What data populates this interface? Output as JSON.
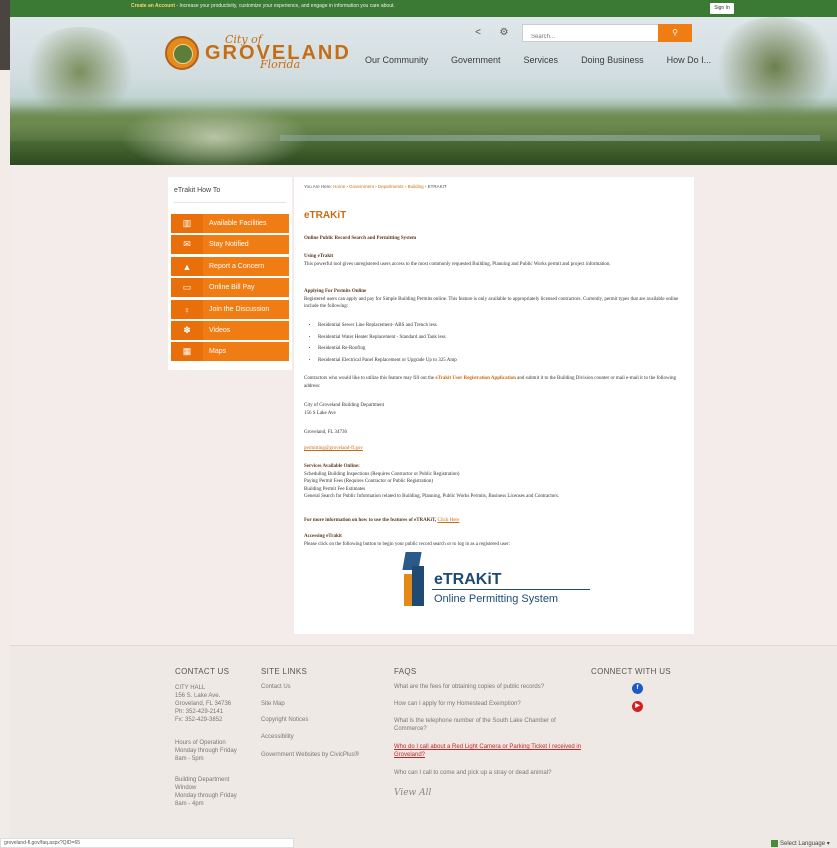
{
  "topbar": {
    "account_link": "Create an Account",
    "account_text": " - Increase your productivity, customize your experience, and engage in information you care about.",
    "signin": "Sign In"
  },
  "logo": {
    "city_of": "City of",
    "name": "GROVELAND",
    "state": "Florida"
  },
  "search": {
    "placeholder": "Search..."
  },
  "icons": {
    "share": "share-icon",
    "settings": "gear-icon",
    "search": "search-icon"
  },
  "nav": [
    "Our Community",
    "Government",
    "Services",
    "Doing Business",
    "How Do I..."
  ],
  "sidebar": {
    "title": "eTrakit How To",
    "items": [
      {
        "label": "Available Facilities",
        "icon": "building-icon"
      },
      {
        "label": "Stay Notified",
        "icon": "envelope-icon"
      },
      {
        "label": "Report a Concern",
        "icon": "bell-icon"
      },
      {
        "label": "Online Bill Pay",
        "icon": "credit-card-icon"
      },
      {
        "label": "Join the Discussion",
        "icon": "microphone-icon"
      },
      {
        "label": "Videos",
        "icon": "film-reel-icon"
      },
      {
        "label": "Maps",
        "icon": "map-icon"
      }
    ]
  },
  "breadcrumb": {
    "prefix": "You Are Here: ",
    "items": [
      "Home",
      "Government",
      "Departments",
      "Building"
    ],
    "current": "ETRAKIT"
  },
  "page": {
    "title": "eTRAKiT",
    "heading": "Online Public Record Search and Permitting System",
    "using_title": "Using eTrakit",
    "using_text": "This powerful tool gives unregistered users access to the most commonly requested Building, Planning and Public Works permit and project information.",
    "applying_title": "Applying For Permits Online",
    "applying_text": "Registered users can apply and pay for Simple Building Permits online. This feature is only available to appropriately licensed contractors. Currently, permit types that are available online include the following:",
    "permit_types": [
      "Residential Sewer Line Replacement- ABS and Trench less",
      "Residential Water Heater Replacement - Standard and Tank less",
      "Residential Re-Roofing",
      "Residential Electrical Panel Replacement or Upgrade Up to 325 Amp"
    ],
    "contractors_pre": "Contractors who would like to utilize this feature may fill out the ",
    "contractors_link": "eTrakit User Registration Application",
    "contractors_post": " and submit it to the Building Division counter or mail e-mail it to the following address:",
    "addr1": "City of Groveland Building Department",
    "addr2": "156 S Lake Ave",
    "addr3": "Groveland, FL 34736",
    "email": "permitting@groveland-fl.gov",
    "services_title": "Services Available Online:",
    "services": [
      "Scheduling Building Inspections (Requires Contractor or Public Registration)",
      "Paying Permit Fees (Requires Contractor or Public Registration)",
      "Building Permit Fee Estimates",
      "General Search for Public Information related to Building, Planning, Public Works Permits, Business Licenses and Contractors."
    ],
    "more_info": "For more information on how to use the features of eTRAKiT, ",
    "click_here": "Click Here",
    "accessing_title": "Accessing eTrakit",
    "accessing_text": "Please click on the following button to begin your public record search or to log in as a registered user:",
    "etrakit_title": "eTRAKiT",
    "etrakit_sub": "Online Permitting System"
  },
  "footer": {
    "contact": {
      "title": "CONTACT US",
      "lines": [
        "CITY HALL",
        "156 S. Lake Ave.",
        "Groveland, FL 34736",
        "Ph: 352-429-2141",
        "Fx: 352-429-3852"
      ],
      "hours": [
        "Hours of Operation",
        "Monday through Friday",
        "8am - 5pm"
      ],
      "bldg": [
        "Building Department",
        "Window",
        "Monday through Friday",
        "8am - 4pm"
      ]
    },
    "site_links": {
      "title": "SITE LINKS",
      "items": [
        "Contact Us",
        "Site Map",
        "Copyright Notices",
        "Accessibility",
        "Government Websites by CivicPlus®"
      ]
    },
    "faqs": {
      "title": "FAQS",
      "items": [
        "What are the fees for obtaining copies of public records?",
        "How can I apply for my Homestead Exemption?",
        "What is the telephone number of the South Lake Chamber of Commerce?",
        "Who do I call about a Red Light Camera or Parking Ticket I received in Groveland?",
        "Who can I call to come and pick up a stray or dead animal?"
      ],
      "view_all": "View All"
    },
    "connect": {
      "title": "CONNECT WITH US",
      "facebook": "f",
      "youtube": "▶"
    }
  },
  "status_url": "groveland-fl.gov/faq.aspx?QID=65",
  "language": "Select Language"
}
